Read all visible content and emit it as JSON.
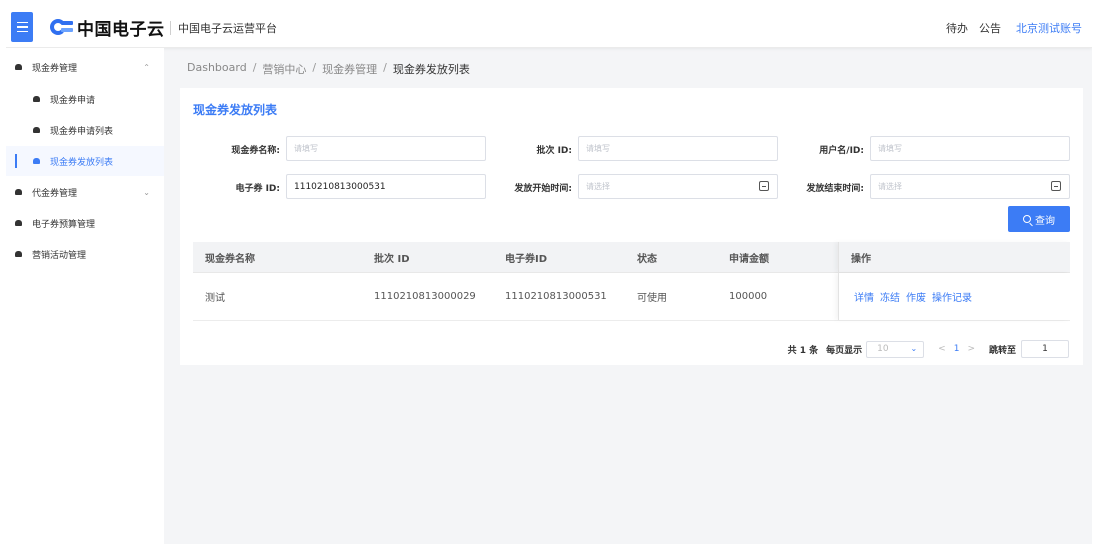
{
  "header": {
    "logo_text": "中国电子云",
    "platform": "中国电子云运营平台",
    "todo": "待办",
    "notice": "公告",
    "account": "北京测试账号"
  },
  "sidebar": {
    "items": [
      {
        "label": "现金券管理",
        "arrow": "⌃"
      },
      {
        "label": "现金券申请"
      },
      {
        "label": "现金券申请列表"
      },
      {
        "label": "现金券发放列表"
      },
      {
        "label": "代金券管理",
        "arrow": "⌄"
      },
      {
        "label": "电子券预算管理"
      },
      {
        "label": "营销活动管理"
      }
    ]
  },
  "breadcrumb": {
    "items": [
      "Dashboard",
      "营销中心",
      "现金券管理",
      "现金券发放列表"
    ],
    "sep": "/"
  },
  "main": {
    "title": "现金券发放列表",
    "filters": {
      "name_label": "现金券名称:",
      "name_placeholder": "请填写",
      "batch_label": "批次 ID:",
      "batch_placeholder": "请填写",
      "user_label": "用户名/ID:",
      "user_placeholder": "请填写",
      "ecoupon_label": "电子券 ID:",
      "ecoupon_value": "1110210813000531",
      "start_label": "发放开始时间:",
      "start_placeholder": "请选择",
      "end_label": "发放结束时间:",
      "end_placeholder": "请选择"
    },
    "search_label": "查询"
  },
  "table": {
    "columns": [
      "现金券名称",
      "批次 ID",
      "电子券ID",
      "状态",
      "申请金额",
      "操作"
    ],
    "rows": [
      {
        "name": "测试",
        "batch_id": "1110210813000029",
        "ecoupon_id": "1110210813000531",
        "status": "可使用",
        "amount": "100000"
      }
    ],
    "actions": [
      "详情",
      "冻结",
      "作废",
      "操作记录"
    ]
  },
  "pagination": {
    "total": "共 1 条",
    "per_page_label": "每页显示",
    "per_page": "10",
    "prev": "<",
    "page": "1",
    "next": ">",
    "jump_label": "跳转至",
    "jump_value": "1"
  },
  "colors": {
    "accent": "#3c7cf5"
  }
}
